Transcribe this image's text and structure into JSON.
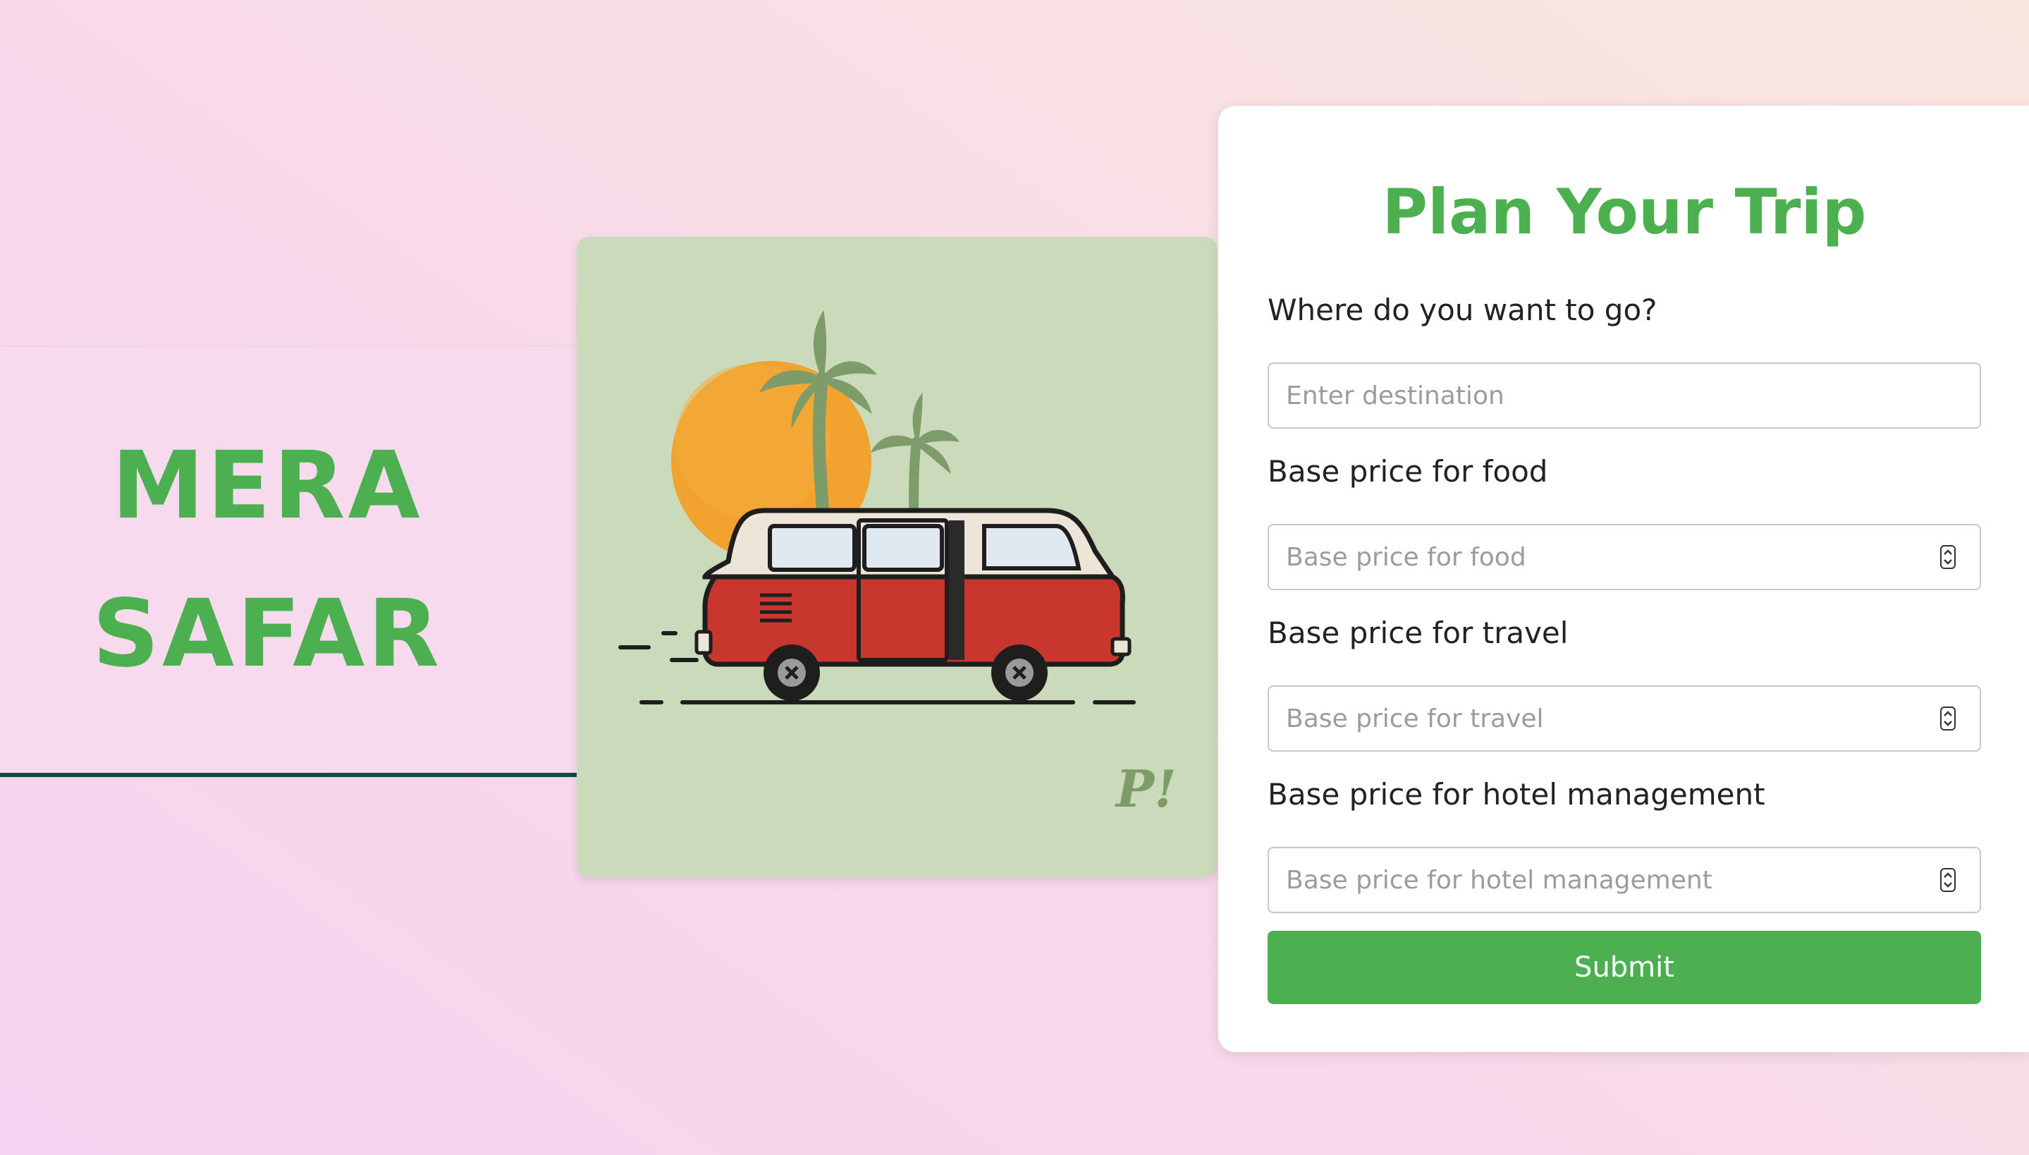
{
  "brand": {
    "line1": "MERA",
    "line2": "SAFAR",
    "accent_color": "#4caf50",
    "underline_color": "#124d3b"
  },
  "illustration": {
    "subject": "red-white-van-with-sun-and-palm-trees",
    "signature": "P!",
    "background_color": "#cbdabb"
  },
  "form": {
    "title": "Plan Your Trip",
    "fields": [
      {
        "label": "Where do you want to go?",
        "placeholder": "Enter destination",
        "value": ""
      },
      {
        "label": "Base price for food",
        "placeholder": "Base price for food",
        "value": ""
      },
      {
        "label": "Base price for travel",
        "placeholder": "Base price for travel",
        "value": ""
      },
      {
        "label": "Base price for hotel management",
        "placeholder": "Base price for hotel management",
        "value": ""
      }
    ],
    "submit_label": "Submit",
    "button_color": "#4caf50"
  }
}
